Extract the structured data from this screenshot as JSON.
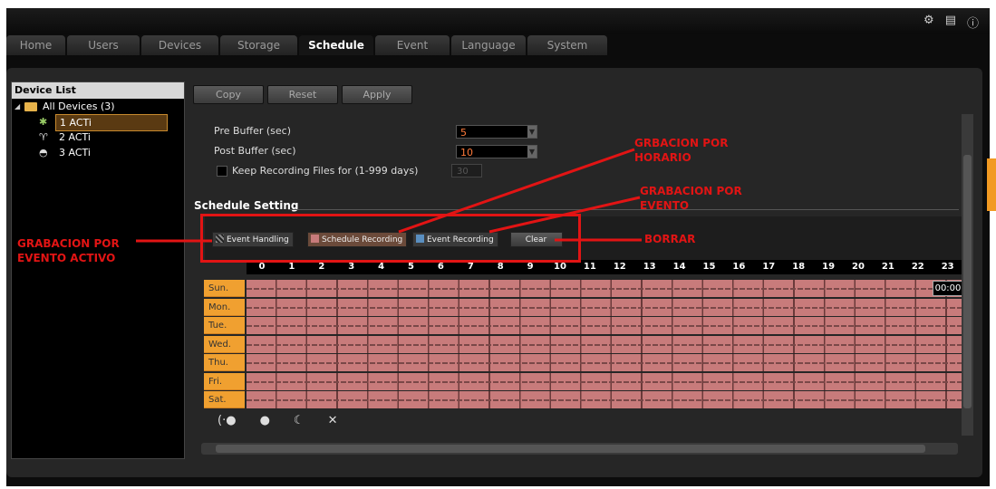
{
  "tabs": [
    "Home",
    "Users",
    "Devices",
    "Storage",
    "Schedule",
    "Event",
    "Language",
    "System"
  ],
  "active_tab": "Schedule",
  "device_list": {
    "title": "Device List",
    "root": "All Devices (3)",
    "devices": [
      "1 ACTi",
      "2 ACTi",
      "3 ACTi"
    ]
  },
  "toolbar": {
    "copy": "Copy",
    "reset": "Reset",
    "apply": "Apply"
  },
  "settings": {
    "pre_buffer_label": "Pre Buffer (sec)",
    "pre_buffer_value": "5",
    "post_buffer_label": "Post Buffer (sec)",
    "post_buffer_value": "10",
    "keep_label": "Keep Recording Files for (1-999 days)",
    "keep_value": "30"
  },
  "schedule": {
    "title": "Schedule Setting",
    "event_handling": "Event Handling",
    "schedule_recording": "Schedule Recording",
    "event_recording": "Event Recording",
    "clear": "Clear",
    "hours": [
      "0",
      "1",
      "2",
      "3",
      "4",
      "5",
      "6",
      "7",
      "8",
      "9",
      "10",
      "11",
      "12",
      "13",
      "14",
      "15",
      "16",
      "17",
      "18",
      "19",
      "20",
      "21",
      "22",
      "23"
    ],
    "days": [
      "Sun.",
      "Mon.",
      "Tue.",
      "Wed.",
      "Thu.",
      "Fri.",
      "Sat."
    ],
    "tooltip": "00:00"
  },
  "annotations": {
    "horario_1": "GRBACION POR",
    "horario_2": "HORARIO",
    "evento_1": "GRABACION POR",
    "evento_2": "EVENTO",
    "borrar": "BORRAR",
    "activo_1": "GRABACION POR",
    "activo_2": "EVENTO ACTIVO"
  },
  "colors": {
    "schedule": "#c87b7b",
    "event": "#5a8fc0",
    "day_label": "#f0a030",
    "annotation": "#e21414"
  }
}
